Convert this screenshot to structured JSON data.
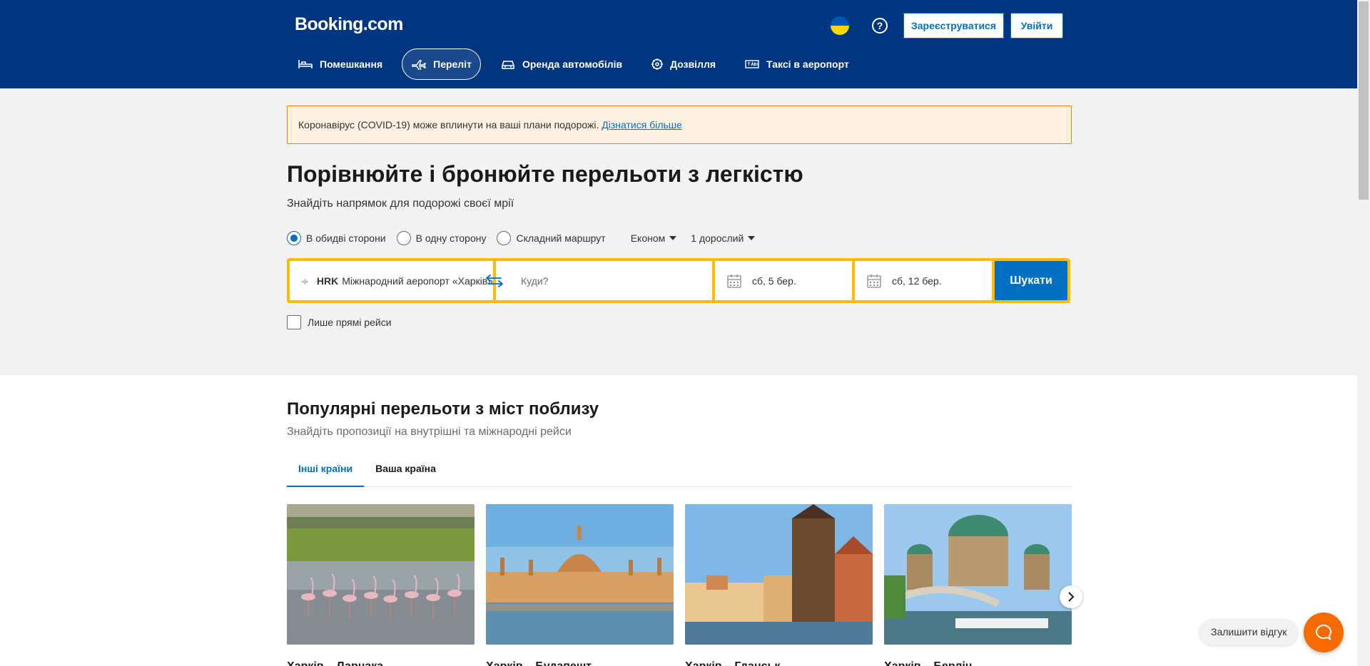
{
  "header": {
    "logo": "Booking.com",
    "help_icon": "?",
    "register_label": "Зареєструватися",
    "login_label": "Увійти",
    "flag_colors": [
      "#0057b7",
      "#ffd700"
    ]
  },
  "nav": {
    "items": [
      {
        "label": "Помешкання",
        "icon": "bed-icon",
        "active": false
      },
      {
        "label": "Переліт",
        "icon": "plane-icon",
        "active": true
      },
      {
        "label": "Оренда автомобілів",
        "icon": "car-icon",
        "active": false
      },
      {
        "label": "Дозвілля",
        "icon": "attractions-icon",
        "active": false
      },
      {
        "label": "Таксі в аеропорт",
        "icon": "taxi-icon",
        "active": false
      }
    ]
  },
  "covid": {
    "text": "Коронавірус (COVID-19) може вплинути на ваші плани подорожі.",
    "link": "Дізнатися більше"
  },
  "hero": {
    "title": "Порівнюйте і бронюйте перельоти з легкістю",
    "subtitle": "Знайдіть напрямок для подорожі своєї мрії"
  },
  "trip_options": {
    "types": [
      {
        "label": "В обидві сторони",
        "checked": true
      },
      {
        "label": "В одну сторону",
        "checked": false
      },
      {
        "label": "Складний маршрут",
        "checked": false
      }
    ],
    "cabin_class": "Економ",
    "passengers": "1 дорослий"
  },
  "search": {
    "from_code": "HRK",
    "from_name": "Міжнародний аеропорт «Харків»",
    "to_placeholder": "Куди?",
    "depart_date": "сб, 5 бер.",
    "return_date": "сб, 12 бер.",
    "button_label": "Шукати",
    "direct_label": "Лише прямі рейси"
  },
  "popular": {
    "title": "Популярні перельоти з міст поблизу",
    "subtitle": "Знайдіть пропозиції на внутрішні та міжнародні рейси",
    "tabs": [
      {
        "label": "Інші країни",
        "active": true
      },
      {
        "label": "Ваша країна",
        "active": false
      }
    ],
    "cards": [
      {
        "title": "Харків – Ларнака"
      },
      {
        "title": "Харків – Будапешт"
      },
      {
        "title": "Харків – Гданськ"
      },
      {
        "title": "Харків – Берлін"
      }
    ]
  },
  "feedback": {
    "label": "Залишити відгук"
  },
  "colors": {
    "brand_blue": "#003580",
    "action_blue": "#0071c2",
    "search_yellow": "#febb02",
    "chat_orange": "#f56b00"
  }
}
